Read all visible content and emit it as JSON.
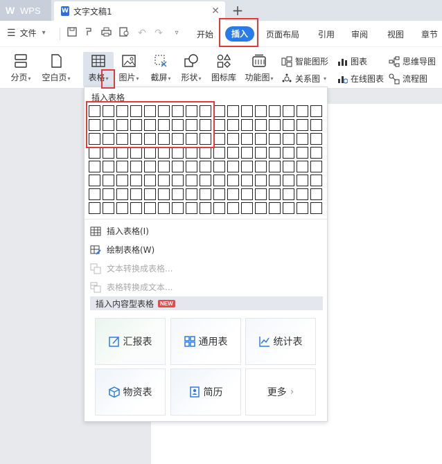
{
  "titlebar": {
    "app_name": "WPS",
    "doc_tab_title": "文字文稿1",
    "close_glyph": "✕",
    "new_tab_glyph": "+"
  },
  "menubar": {
    "file_label": "文件",
    "tabs": [
      "开始",
      "插入",
      "页面布局",
      "引用",
      "审阅",
      "视图",
      "章节"
    ],
    "active_tab": "插入"
  },
  "ribbon": {
    "buttons": [
      {
        "label": "分页",
        "icon": "page-break-icon"
      },
      {
        "label": "空白页",
        "icon": "blank-page-icon"
      },
      {
        "label": "表格",
        "icon": "table-icon"
      },
      {
        "label": "图片",
        "icon": "picture-icon"
      },
      {
        "label": "截屏",
        "icon": "screenshot-icon"
      },
      {
        "label": "形状",
        "icon": "shape-icon"
      },
      {
        "label": "图标库",
        "icon": "icon-library-icon"
      },
      {
        "label": "功能图",
        "icon": "function-chart-icon"
      }
    ],
    "small_buttons": [
      {
        "label": "智能图形",
        "icon": "smart-graphic-icon"
      },
      {
        "label": "关系图",
        "icon": "relation-chart-icon"
      },
      {
        "label": "图表",
        "icon": "chart-icon"
      },
      {
        "label": "在线图表",
        "icon": "online-chart-icon"
      },
      {
        "label": "思维导图",
        "icon": "mind-map-icon"
      },
      {
        "label": "流程图",
        "icon": "flowchart-icon"
      }
    ]
  },
  "dropdown": {
    "title": "插入表格",
    "grid": {
      "rows": 8,
      "cols": 17,
      "highlight_rows": 3,
      "highlight_cols": 9
    },
    "items": [
      {
        "label": "插入表格(I)",
        "enabled": true
      },
      {
        "label": "绘制表格(W)",
        "enabled": true
      },
      {
        "label": "文本转换成表格...",
        "enabled": false
      },
      {
        "label": "表格转换成文本...",
        "enabled": false
      }
    ],
    "section_title": "插入内容型表格",
    "section_badge": "NEW",
    "cards": [
      {
        "label": "汇报表",
        "icon": "report-table-icon"
      },
      {
        "label": "通用表",
        "icon": "general-table-icon"
      },
      {
        "label": "统计表",
        "icon": "statistics-table-icon"
      },
      {
        "label": "物资表",
        "icon": "materials-table-icon"
      },
      {
        "label": "简历",
        "icon": "resume-icon"
      },
      {
        "label": "更多",
        "icon": "chevron-right-icon"
      }
    ]
  },
  "colors": {
    "accent": "#2a7bea",
    "highlight_red": "#e53935",
    "new_badge": "#e84a4a"
  }
}
